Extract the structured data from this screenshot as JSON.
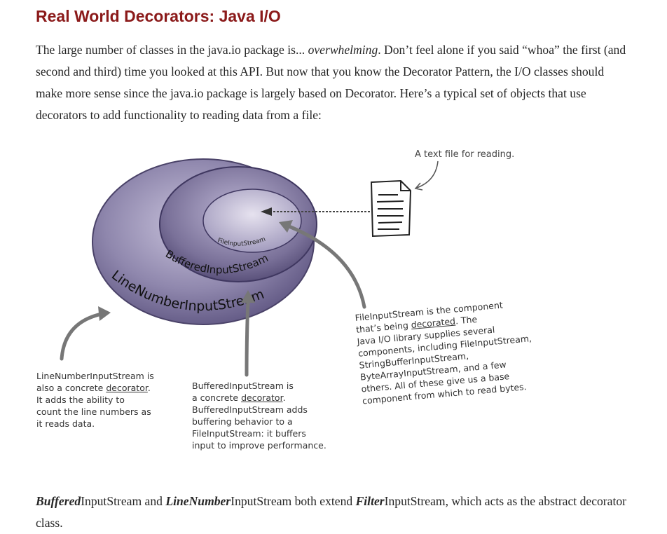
{
  "title": "Real World Decorators: Java I/O",
  "intro": {
    "part1": "The large number of classes in the java.io package is... ",
    "emphasis": "overwhelming",
    "part2": ". Don’t feel alone if you said “whoa” the first (and second and third) time you looked at this API. But now that you know the Decorator Pattern, the I/O classes should make more sense since the java.io package is largely based on Decorator. Here’s a typical set of objects that use decorators to add functionality to reading data from a file:"
  },
  "diagram": {
    "text_file_label": "A text file for reading.",
    "inner_label": "FileInputStream",
    "middle_label": "BufferedInputStream",
    "outer_label": "LineNumberInputStream",
    "note_line_number": {
      "text1": "LineNumberInputStream is\nalso a concrete ",
      "underlined": "decorator",
      "text2": ".\nIt adds the ability to\ncount the line numbers as\nit reads data."
    },
    "note_buffered": {
      "text1": "BufferedInputStream is\na concrete ",
      "underlined": "decorator",
      "text2": ".\nBufferedInputStream adds\nbuffering behavior to a\nFileInputStream: it buffers\ninput to improve performance."
    },
    "note_file": {
      "text1": "FileInputStream is the component\nthat’s being ",
      "underlined": "decorated",
      "text2": ". The\nJava I/O library supplies several\ncomponents, including FileInputStream,\nStringBufferInputStream,\nByteArrayInputStream, and a few\nothers. All of these give us a base\ncomponent from which to read bytes."
    },
    "colors": {
      "outer": "#8a82a8",
      "middle": "#6e6590",
      "inner": "#b4aecb",
      "ink": "#555555"
    }
  },
  "caption": {
    "b1": "Buffered",
    "t1": "InputStream and ",
    "b2": "LineNumber",
    "t2": "InputStream both extend ",
    "b3": "Filter",
    "t3": "InputStream, which acts as the abstract decorator class."
  }
}
